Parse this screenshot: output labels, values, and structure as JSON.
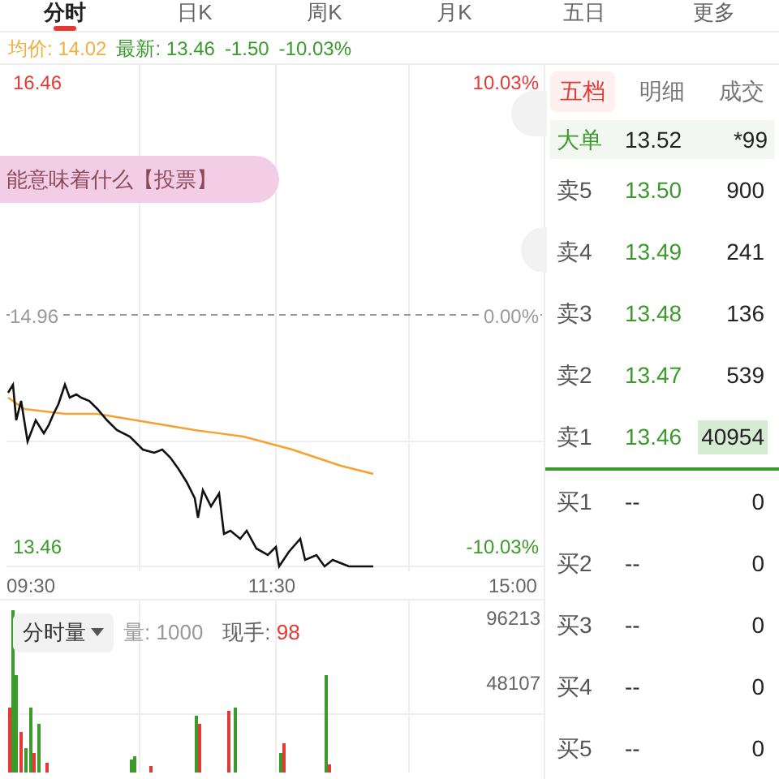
{
  "tabs": [
    {
      "label": "分时",
      "selected": true
    },
    {
      "label": "日K",
      "selected": false
    },
    {
      "label": "周K",
      "selected": false
    },
    {
      "label": "月K",
      "selected": false
    },
    {
      "label": "五日",
      "selected": false
    },
    {
      "label": "更多",
      "selected": false
    }
  ],
  "summary": {
    "avg_label": "均价:",
    "avg": "14.02",
    "latest_label": "最新:",
    "latest": "13.46",
    "change": "-1.50",
    "change_pct": "-10.03%"
  },
  "price_chart": {
    "high": "16.46",
    "high_pct": "10.03%",
    "mid": "14.96",
    "mid_pct": "0.00%",
    "low": "13.46",
    "low_pct": "-10.03%",
    "times": [
      "09:30",
      "11:30",
      "15:00"
    ]
  },
  "banner": "能意味着什么【投票】",
  "volume": {
    "dropdown": "分时量",
    "vol_label": "量:",
    "vol": "1000",
    "hand_label": "现手:",
    "hand": "98",
    "ticks": [
      "96213",
      "48107"
    ]
  },
  "order_tabs": [
    {
      "label": "五档",
      "selected": true
    },
    {
      "label": "明细",
      "selected": false
    },
    {
      "label": "成交",
      "selected": false
    }
  ],
  "big_order": {
    "label": "大单",
    "price": "13.52",
    "volume": "*99"
  },
  "asks": [
    {
      "label": "卖5",
      "price": "13.50",
      "volume": "900",
      "highlighted": false
    },
    {
      "label": "卖4",
      "price": "13.49",
      "volume": "241",
      "highlighted": false
    },
    {
      "label": "卖3",
      "price": "13.48",
      "volume": "136",
      "highlighted": false
    },
    {
      "label": "卖2",
      "price": "13.47",
      "volume": "539",
      "highlighted": false
    },
    {
      "label": "卖1",
      "price": "13.46",
      "volume": "40954",
      "highlighted": true
    }
  ],
  "bids": [
    {
      "label": "买1",
      "price": "--",
      "volume": "0"
    },
    {
      "label": "买2",
      "price": "--",
      "volume": "0"
    },
    {
      "label": "买3",
      "price": "--",
      "volume": "0"
    },
    {
      "label": "买4",
      "price": "--",
      "volume": "0"
    },
    {
      "label": "买5",
      "price": "--",
      "volume": "0"
    }
  ]
}
